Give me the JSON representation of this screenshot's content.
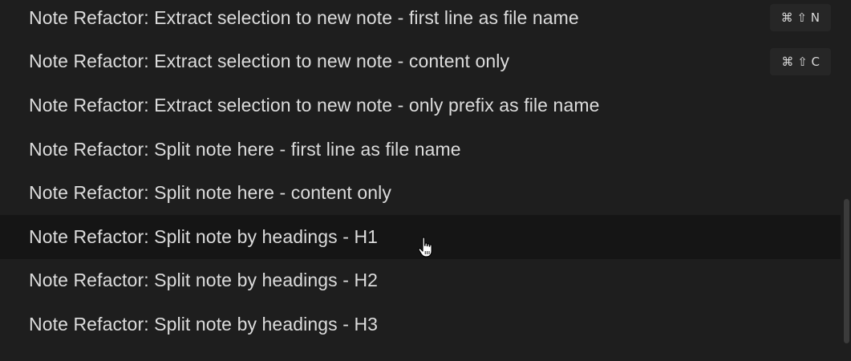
{
  "command_palette": {
    "items": [
      {
        "label": "Note Refactor: Extract selection to new note - first line as file name",
        "hotkey": "⌘ ⇧ N"
      },
      {
        "label": "Note Refactor: Extract selection to new note - content only",
        "hotkey": "⌘ ⇧ C"
      },
      {
        "label": "Note Refactor: Extract selection to new note - only prefix as file name"
      },
      {
        "label": "Note Refactor: Split note here - first line as file name"
      },
      {
        "label": "Note Refactor: Split note here - content only"
      },
      {
        "label": "Note Refactor: Split note by headings - H1",
        "selected": true
      },
      {
        "label": "Note Refactor: Split note by headings - H2"
      },
      {
        "label": "Note Refactor: Split note by headings - H3"
      }
    ]
  },
  "colors": {
    "background": "#1e1e1e",
    "selected_row": "#151515",
    "text": "#dcdcdc",
    "hotkey_bg": "#262626"
  },
  "icons": {
    "cursor": "hand-pointer-icon"
  }
}
